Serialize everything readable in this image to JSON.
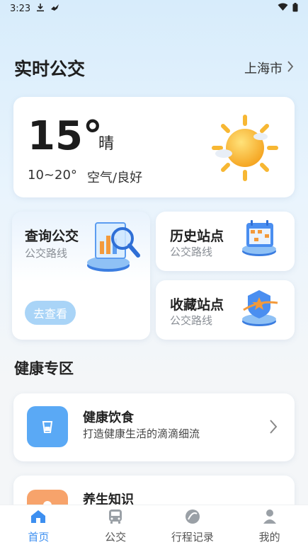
{
  "status_bar": {
    "time": "3:23",
    "icons": [
      "download-icon",
      "bird-icon",
      "wifi-icon",
      "battery-icon"
    ]
  },
  "header": {
    "title": "实时公交",
    "city": "上海市"
  },
  "weather": {
    "temperature": "15°",
    "condition": "晴",
    "range": "10~20°",
    "air": "空气/良好",
    "icon": "sun-cloud-icon"
  },
  "features": {
    "query": {
      "title": "查询公交",
      "subtitle": "公交路线",
      "button": "去查看"
    },
    "history": {
      "title": "历史站点",
      "subtitle": "公交路线"
    },
    "favorites": {
      "title": "收藏站点",
      "subtitle": "公交路线"
    }
  },
  "health": {
    "section_title": "健康专区",
    "items": [
      {
        "title": "健康饮食",
        "subtitle": "打造健康生活的滴滴细流",
        "icon": "cup-icon",
        "color": "#5aa9f5"
      },
      {
        "title": "养生知识",
        "subtitle": "",
        "icon": "leaf-icon",
        "color": "#f7a36b"
      }
    ]
  },
  "tabs": [
    {
      "label": "首页",
      "icon": "home-icon",
      "active": true
    },
    {
      "label": "公交",
      "icon": "bus-icon",
      "active": false
    },
    {
      "label": "行程记录",
      "icon": "record-icon",
      "active": false
    },
    {
      "label": "我的",
      "icon": "user-icon",
      "active": false
    }
  ],
  "colors": {
    "accent": "#3d8ff0",
    "button": "#a9d4f7"
  }
}
